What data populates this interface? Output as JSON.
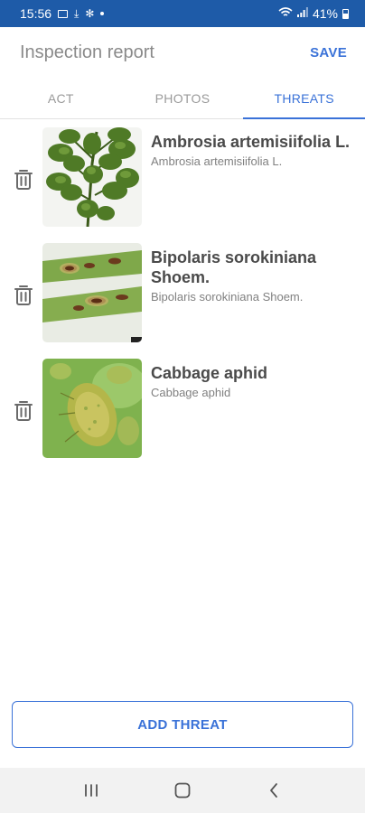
{
  "status_bar": {
    "time": "15:56",
    "battery": "41%",
    "icons": [
      "gallery-icon",
      "download-check-icon",
      "gear-icon",
      "dot-icon",
      "wifi-icon",
      "signal-icon",
      "battery-icon"
    ]
  },
  "app_bar": {
    "title": "Inspection report",
    "save_label": "SAVE"
  },
  "tabs": [
    {
      "label": "ACT",
      "active": false
    },
    {
      "label": "PHOTOS",
      "active": false
    },
    {
      "label": "THREATS",
      "active": true
    }
  ],
  "threats": [
    {
      "title": "Ambrosia artemisiifolia L.",
      "subtitle": "Ambrosia artemisiifolia L.",
      "image": "ragweed-plant-photo"
    },
    {
      "title": "Bipolaris sorokiniana Shoem.",
      "subtitle": "Bipolaris sorokiniana Shoem.",
      "image": "leaf-spot-photo"
    },
    {
      "title": "Cabbage aphid",
      "subtitle": "Cabbage aphid",
      "image": "aphid-photo"
    }
  ],
  "add_threat_label": "ADD THREAT",
  "nav_bar": {
    "icons": [
      "recent-apps-icon",
      "home-icon",
      "back-icon"
    ]
  },
  "colors": {
    "accent": "#3a72d8",
    "status_bar": "#1e5ba8",
    "title_gray": "#8a8a8a"
  }
}
